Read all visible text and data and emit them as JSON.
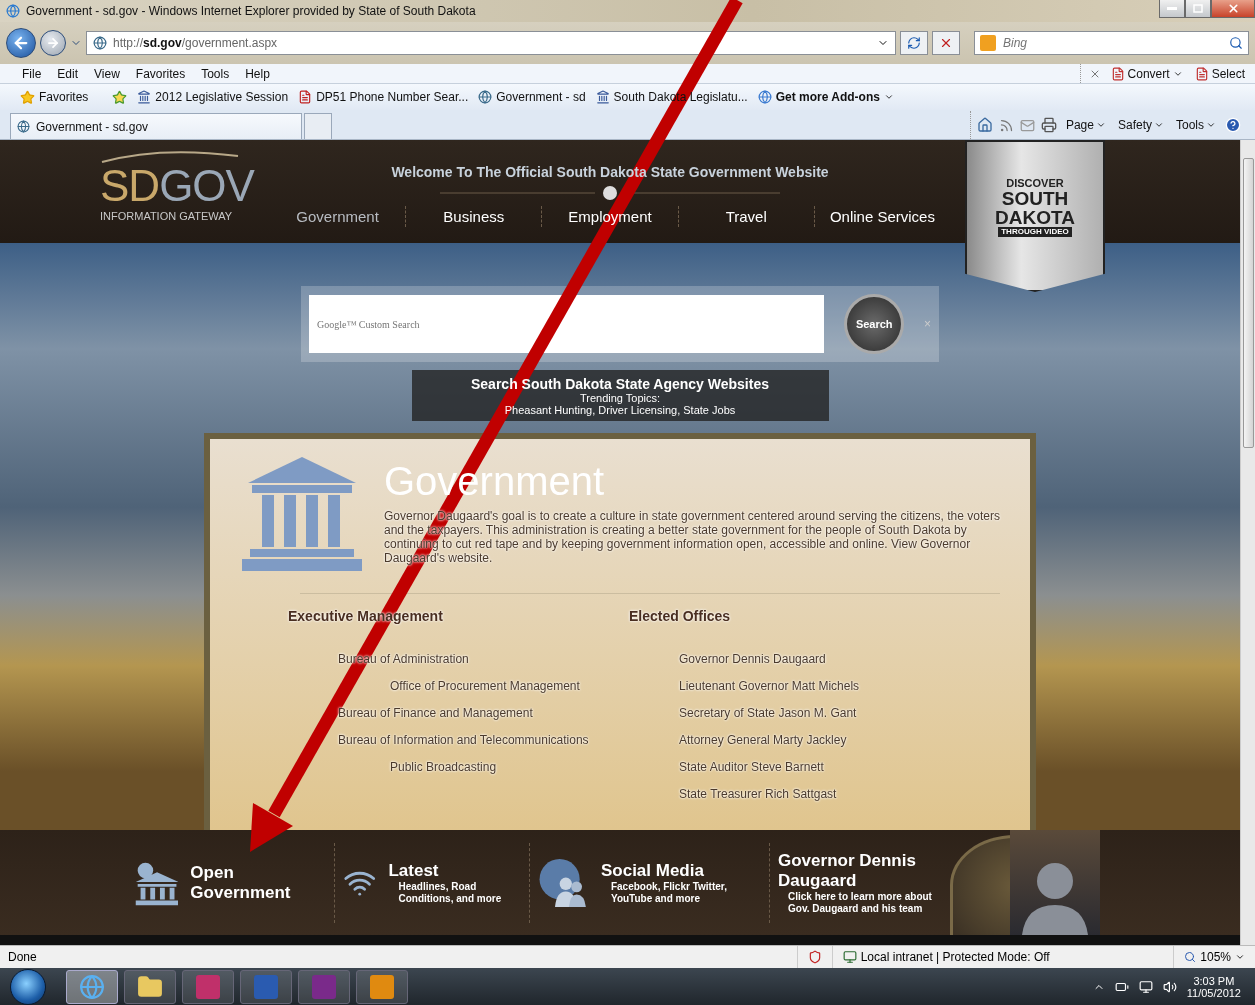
{
  "window": {
    "title": "Government - sd.gov - Windows Internet Explorer provided by State of South Dakota"
  },
  "address_bar": {
    "url": "http://**sd.gov**/government.aspx"
  },
  "search_box": {
    "placeholder": "Bing"
  },
  "menu_bar": [
    "File",
    "Edit",
    "View",
    "Favorites",
    "Tools",
    "Help"
  ],
  "addon_toolbar": [
    "Convert",
    "Select"
  ],
  "favorites_bar": {
    "favorites_button": "Favorites",
    "links": [
      {
        "label": "2012 Legislative Session",
        "kind": "capitol"
      },
      {
        "label": "DP51 Phone Number Sear...",
        "kind": "state"
      },
      {
        "label": "Government - sd",
        "kind": "globe"
      },
      {
        "label": "South Dakota Legislatu...",
        "kind": "capitol"
      }
    ],
    "addons": "Get more Add-ons"
  },
  "tabs": [
    {
      "label": "Government - sd.gov",
      "selected": true
    },
    {
      "selected": false
    }
  ],
  "command_bar": [
    "Page",
    "Safety",
    "Tools"
  ],
  "site": {
    "logo": {
      "left": "SD",
      "right": "GOV",
      "subtitle": "INFORMATION GATEWAY"
    },
    "welcome": "Welcome To The Official South Dakota State Government Website",
    "nav": [
      {
        "label": "Government",
        "selected": true
      },
      {
        "label": "Business",
        "selected": false
      },
      {
        "label": "Employment",
        "selected": false
      },
      {
        "label": "Travel",
        "selected": false
      },
      {
        "label": "Online Services",
        "selected": false
      }
    ],
    "video_badge": {
      "top": "DISCOVER",
      "line1": "SOUTH",
      "line2": "DAKOTA",
      "bottom": "THROUGH VIDEO"
    },
    "search": {
      "placeholder": "Google™ Custom Search",
      "button": "Search",
      "clear": "×"
    },
    "agency_box": {
      "title": "Search South Dakota State Agency Websites",
      "subtitle": "Trending Topics:",
      "topics": "Pheasant Hunting, Driver Licensing, State Jobs"
    },
    "panel": {
      "title": "Government",
      "intro": "Governor Daugaard's goal is to create a culture in state government centered around serving the citizens, the voters and the taxpayers. This administration is creating a better state government for the people of South Dakota by continuing to cut red tape and by keeping government information open, accessible and online. View Governor Daugaard's website.",
      "columns": [
        {
          "heading": "Executive Management",
          "items": [
            {
              "label": "Bureau of Administration",
              "children": [
                {
                  "label": "Office of Procurement Management"
                }
              ]
            },
            {
              "label": "Bureau of Finance and Management"
            },
            {
              "label": "Bureau of Information and Telecommunications",
              "children": [
                {
                  "label": "Public Broadcasting"
                }
              ]
            }
          ]
        },
        {
          "heading": "Elected Offices",
          "items": [
            {
              "label": "Governor Dennis Daugaard"
            },
            {
              "label": "Lieutenant Governor Matt Michels"
            },
            {
              "label": "Secretary of State Jason M. Gant"
            },
            {
              "label": "Attorney General Marty Jackley"
            },
            {
              "label": "State Auditor Steve Barnett"
            },
            {
              "label": "State Treasurer Rich Sattgast"
            }
          ]
        }
      ]
    },
    "footer_links": [
      {
        "kind": "open",
        "title": "Open Government"
      },
      {
        "kind": "latest",
        "title": "Latest",
        "subtitle": "Headlines, Road Conditions, and more"
      },
      {
        "kind": "social",
        "title": "Social Media",
        "subtitle": "Facebook, Flickr Twitter, YouTube and more"
      },
      {
        "kind": "governor",
        "title": "Governor Dennis Daugaard",
        "subtitle": "Click here to learn more about Gov. Daugaard and his team"
      }
    ]
  },
  "status_bar": {
    "text": "Done",
    "zone": "Local intranet | Protected Mode: Off",
    "zoom": "105%"
  },
  "taskbar": {
    "apps": [
      {
        "kind": "browser",
        "selected": true
      },
      {
        "kind": "folder",
        "selected": false
      },
      {
        "kind": "app",
        "color": "#c0306a",
        "selected": false
      },
      {
        "kind": "app",
        "color": "#2a5bb0",
        "selected": false
      },
      {
        "kind": "app",
        "color": "#7a2a8a",
        "selected": false
      },
      {
        "kind": "app",
        "color": "#e08a10",
        "selected": false
      }
    ],
    "time": "3:03 PM",
    "date": "11/05/2012"
  }
}
